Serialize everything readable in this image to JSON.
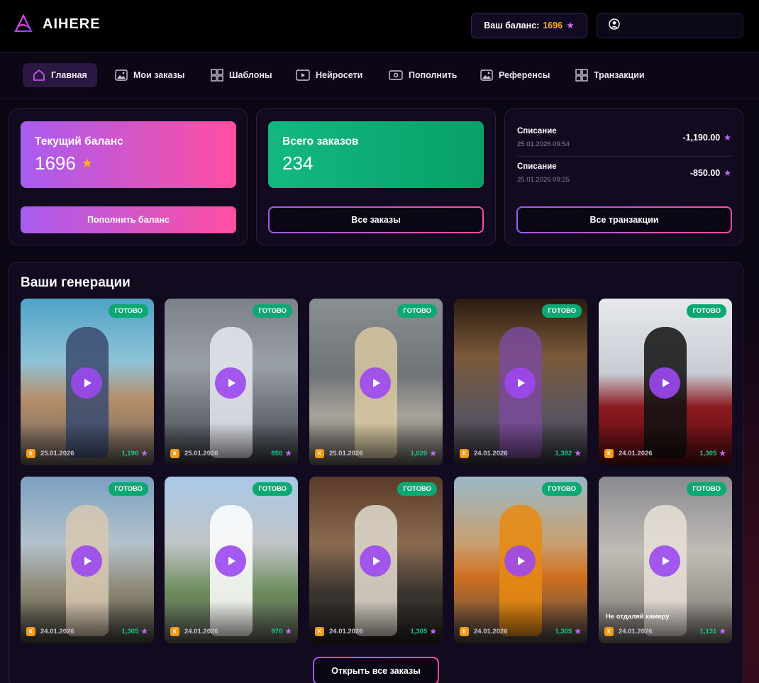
{
  "app": {
    "name": "AIHERE",
    "logo_icon": "logo-a-triangle-icon"
  },
  "header": {
    "balance_label": "Ваш баланс:",
    "balance_value": "1696",
    "star_icon": "star-icon",
    "user_icon": "user-icon"
  },
  "nav": {
    "items": [
      {
        "label": "Главная",
        "icon": "home-icon",
        "active": true
      },
      {
        "label": "Мои заказы",
        "icon": "image-icon"
      },
      {
        "label": "Шаблоны",
        "icon": "grid-icon"
      },
      {
        "label": "Нейросети",
        "icon": "play-box-icon"
      },
      {
        "label": "Пополнить",
        "icon": "wallet-icon"
      },
      {
        "label": "Референсы",
        "icon": "image-icon"
      },
      {
        "label": "Транзакции",
        "icon": "grid-icon"
      }
    ]
  },
  "cards": {
    "balance": {
      "label": "Текущий баланс",
      "value": "1696",
      "button": "Пополнить баланс"
    },
    "orders": {
      "label": "Всего заказов",
      "value": "234",
      "button": "Все заказы"
    },
    "transactions": {
      "rows": [
        {
          "title": "Списание",
          "date": "25.01.2026 09:54",
          "amount": "-1,190.00"
        },
        {
          "title": "Списание",
          "date": "25.01.2026 09:25",
          "amount": "-850.00"
        }
      ],
      "button": "Все транзакции"
    }
  },
  "generations": {
    "title": "Ваши генерации",
    "status": "ГОТОВО",
    "k_label": "К",
    "items": [
      {
        "date": "25.01.2026",
        "price": "1,190",
        "caption": ""
      },
      {
        "date": "25.01.2026",
        "price": "850",
        "caption": ""
      },
      {
        "date": "25.01.2026",
        "price": "1,020",
        "caption": ""
      },
      {
        "date": "24.01.2026",
        "price": "1,392",
        "caption": ""
      },
      {
        "date": "24.01.2026",
        "price": "1,305",
        "caption": ""
      },
      {
        "date": "24.01.2026",
        "price": "1,305",
        "caption": ""
      },
      {
        "date": "24.01.2026",
        "price": "870",
        "caption": ""
      },
      {
        "date": "24.01.2026",
        "price": "1,305",
        "caption": ""
      },
      {
        "date": "24.01.2026",
        "price": "1,305",
        "caption": ""
      },
      {
        "date": "24.01.2026",
        "price": "1,131",
        "caption": "Не отдаляй камеру"
      }
    ],
    "open_all": "Открыть все заказы"
  },
  "colors": {
    "accent_pink": "#ff4fa0",
    "accent_purple": "#a85cf0",
    "accent_green": "#0aa872",
    "gold": "#f5b300"
  }
}
